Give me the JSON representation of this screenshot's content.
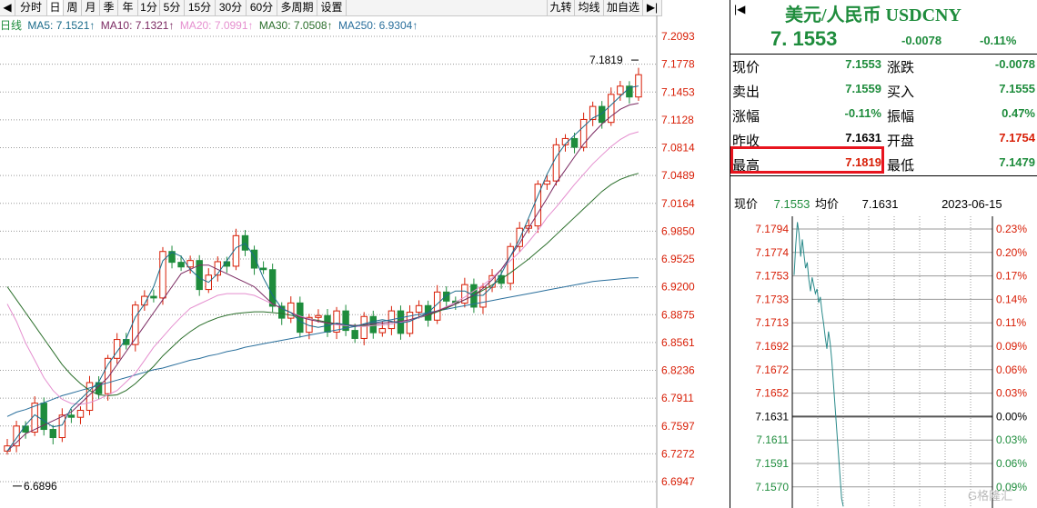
{
  "toolbar": {
    "items": [
      "分时",
      "日",
      "周",
      "月",
      "季",
      "年",
      "1分",
      "5分",
      "15分",
      "30分",
      "60分",
      "多周期",
      "设置"
    ],
    "active": "日",
    "right_items": [
      "九转",
      "均线",
      "加自选"
    ]
  },
  "ma_line": {
    "period": "日线",
    "ma5": "MA5: 7.1521↑",
    "ma10": "MA10: 7.1321↑",
    "ma20": "MA20: 7.0991↑",
    "ma30": "MA30: 7.0508↑",
    "ma250": "MA250: 6.9304↑",
    "colors": {
      "ma5": "#1a6b8a",
      "ma10": "#7b2a62",
      "ma20": "#e58fcf",
      "ma30": "#2b6f2b",
      "ma250": "#2a6f9c"
    }
  },
  "kchart": {
    "y_labels": [
      "7.2093",
      "7.1778",
      "7.1453",
      "7.1128",
      "7.0814",
      "7.0489",
      "7.0164",
      "6.9850",
      "6.9525",
      "6.9200",
      "6.8875",
      "6.8561",
      "6.8236",
      "6.7911",
      "6.7597",
      "6.7272",
      "6.6947"
    ],
    "high_marker": "7.1819",
    "low_marker": "6.6896"
  },
  "chart_data": {
    "type": "candlestick",
    "title": "美元/人民币 USDCNY 日线",
    "ylim": [
      6.6947,
      7.2093
    ],
    "y_ticks": [
      7.2093,
      7.1778,
      7.1453,
      7.1128,
      7.0814,
      7.0489,
      7.0164,
      6.985,
      6.9525,
      6.92,
      6.8875,
      6.8561,
      6.8236,
      6.7911,
      6.7597,
      6.7272,
      6.6947
    ],
    "max": 7.1819,
    "min": 6.6896,
    "series_ma5": [
      6.73,
      6.745,
      6.76,
      6.772,
      6.765,
      6.758,
      6.76,
      6.78,
      6.79,
      6.8,
      6.81,
      6.83,
      6.845,
      6.86,
      6.885,
      6.9,
      6.92,
      6.95,
      6.96,
      6.955,
      6.94,
      6.93,
      6.925,
      6.935,
      6.95,
      6.965,
      6.97,
      6.955,
      6.93,
      6.91,
      6.895,
      6.89,
      6.88,
      6.875,
      6.873,
      6.875,
      6.878,
      6.876,
      6.874,
      6.877,
      6.88,
      6.882,
      6.88,
      6.878,
      6.88,
      6.885,
      6.89,
      6.9,
      6.91,
      6.915,
      6.915,
      6.91,
      6.91,
      6.92,
      6.935,
      6.955,
      6.975,
      7.0,
      7.025,
      7.05,
      7.07,
      7.085,
      7.095,
      7.105,
      7.115,
      7.12,
      7.13,
      7.14,
      7.15,
      7.152
    ],
    "series_ma10": [
      6.73,
      6.74,
      6.75,
      6.755,
      6.76,
      6.765,
      6.77,
      6.775,
      6.785,
      6.795,
      6.805,
      6.815,
      6.83,
      6.845,
      6.86,
      6.875,
      6.89,
      6.905,
      6.92,
      6.935,
      6.94,
      6.945,
      6.945,
      6.94,
      6.935,
      6.93,
      6.925,
      6.92,
      6.91,
      6.9,
      6.895,
      6.89,
      6.885,
      6.882,
      6.88,
      6.878,
      6.877,
      6.876,
      6.875,
      6.876,
      6.877,
      6.878,
      6.879,
      6.88,
      6.882,
      6.885,
      6.888,
      6.892,
      6.896,
      6.9,
      6.905,
      6.91,
      6.918,
      6.928,
      6.94,
      6.955,
      6.97,
      6.988,
      7.005,
      7.022,
      7.04,
      7.055,
      7.07,
      7.085,
      7.097,
      7.108,
      7.117,
      7.125,
      7.13,
      7.132
    ],
    "series_ma20": [
      6.9,
      6.88,
      6.855,
      6.835,
      6.815,
      6.8,
      6.79,
      6.785,
      6.784,
      6.786,
      6.79,
      6.795,
      6.8,
      6.81,
      6.82,
      6.835,
      6.85,
      6.862,
      6.874,
      6.885,
      6.895,
      6.9,
      6.905,
      6.91,
      6.912,
      6.912,
      6.912,
      6.91,
      6.905,
      6.9,
      6.895,
      6.89,
      6.886,
      6.883,
      6.88,
      6.878,
      6.876,
      6.875,
      6.874,
      6.874,
      6.875,
      6.876,
      6.877,
      6.879,
      6.881,
      6.884,
      6.888,
      6.892,
      6.897,
      6.902,
      6.908,
      6.915,
      6.922,
      6.93,
      6.94,
      6.95,
      6.96,
      6.972,
      6.985,
      7.0,
      7.012,
      7.025,
      7.038,
      7.05,
      7.062,
      7.072,
      7.082,
      7.09,
      7.096,
      7.099
    ],
    "series_ma30": [
      6.92,
      6.905,
      6.89,
      6.875,
      6.86,
      6.845,
      6.83,
      6.818,
      6.808,
      6.8,
      6.795,
      6.794,
      6.795,
      6.8,
      6.808,
      6.818,
      6.828,
      6.84,
      6.85,
      6.86,
      6.868,
      6.875,
      6.88,
      6.884,
      6.887,
      6.889,
      6.89,
      6.891,
      6.891,
      6.89,
      6.889,
      6.887,
      6.885,
      6.883,
      6.881,
      6.879,
      6.877,
      6.876,
      6.875,
      6.875,
      6.875,
      6.876,
      6.877,
      6.879,
      6.881,
      6.884,
      6.887,
      6.891,
      6.895,
      6.9,
      6.905,
      6.91,
      6.916,
      6.922,
      6.929,
      6.936,
      6.944,
      6.952,
      6.961,
      6.97,
      6.98,
      6.99,
      7.0,
      7.01,
      7.02,
      7.03,
      7.038,
      7.044,
      7.048,
      7.051
    ],
    "series_ma250": [
      6.77,
      6.775,
      6.778,
      6.782,
      6.786,
      6.79,
      6.794,
      6.797,
      6.8,
      6.803,
      6.806,
      6.809,
      6.812,
      6.815,
      6.818,
      6.821,
      6.824,
      6.826,
      6.829,
      6.832,
      6.835,
      6.837,
      6.84,
      6.842,
      6.845,
      6.847,
      6.85,
      6.852,
      6.854,
      6.856,
      6.858,
      6.86,
      6.862,
      6.864,
      6.866,
      6.868,
      6.87,
      6.872,
      6.874,
      6.876,
      6.878,
      6.88,
      6.882,
      6.884,
      6.886,
      6.888,
      6.89,
      6.892,
      6.894,
      6.896,
      6.898,
      6.9,
      6.902,
      6.904,
      6.906,
      6.908,
      6.91,
      6.912,
      6.914,
      6.916,
      6.918,
      6.92,
      6.922,
      6.924,
      6.926,
      6.927,
      6.928,
      6.929,
      6.93,
      6.9304
    ]
  },
  "right_panel": {
    "title": "美元/人民币 USDCNY",
    "price": "7. 1553",
    "change": "-0.0078",
    "change_pct": "-0.11%",
    "quotes": [
      {
        "l1": "现价",
        "v1": "7.1553",
        "c1": "g",
        "l2": "涨跌",
        "v2": "-0.0078",
        "c2": "g"
      },
      {
        "l1": "卖出",
        "v1": "7.1559",
        "c1": "g",
        "l2": "买入",
        "v2": "7.1555",
        "c2": "g"
      },
      {
        "l1": "涨幅",
        "v1": "-0.11%",
        "c1": "g",
        "l2": "振幅",
        "v2": "0.47%",
        "c2": "g"
      },
      {
        "l1": "昨收",
        "v1": "7.1631",
        "c1": "k",
        "l2": "开盘",
        "v2": "7.1754",
        "c2": "r"
      },
      {
        "l1": "最高",
        "v1": "7.1819",
        "c1": "r",
        "l2": "最低",
        "v2": "7.1479",
        "c2": "g"
      }
    ],
    "intraday_info": {
      "price_label": "现价",
      "price": "7.1553",
      "avg_label": "均价",
      "avg": "7.1631",
      "date": "2023-06-15"
    },
    "intraday_left": [
      "7.1794",
      "7.1774",
      "7.1753",
      "7.1733",
      "7.1713",
      "7.1692",
      "7.1672",
      "7.1652",
      "7.1631",
      "7.1611",
      "7.1591",
      "7.1570"
    ],
    "intraday_right": [
      "0.23%",
      "0.20%",
      "0.17%",
      "0.14%",
      "0.11%",
      "0.09%",
      "0.06%",
      "0.03%",
      "0.00%",
      "0.03%",
      "0.06%",
      "0.09%"
    ]
  },
  "watermark": "G格隆汇",
  "colors": {
    "up": "#d81e06",
    "down": "#1e8c3c",
    "text_red": "#d81e06",
    "text_green": "#1e8c3c",
    "highlight": "#e8141e"
  }
}
